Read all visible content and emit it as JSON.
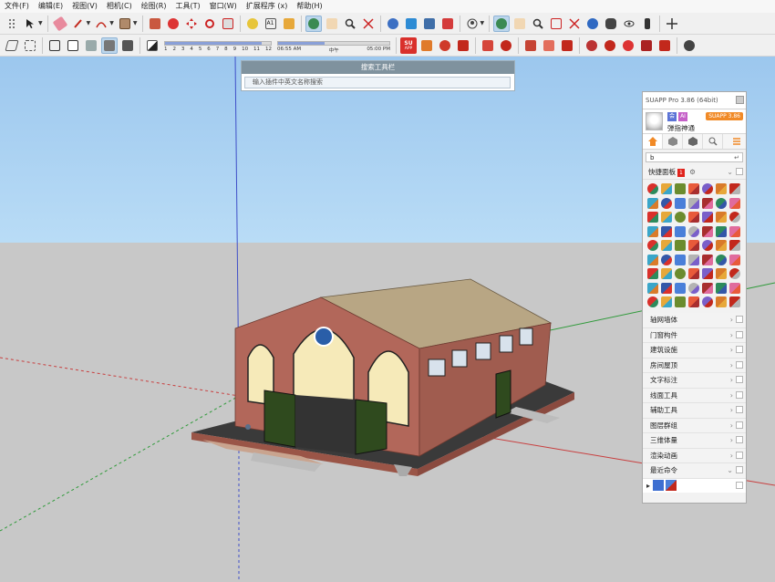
{
  "menu": [
    "文件(F)",
    "编辑(E)",
    "视图(V)",
    "相机(C)",
    "绘图(R)",
    "工具(T)",
    "窗口(W)",
    "扩展程序 (x)",
    "帮助(H)"
  ],
  "shadow_slider": {
    "months": [
      "1",
      "2",
      "3",
      "4",
      "5",
      "6",
      "7",
      "8",
      "9",
      "10",
      "11",
      "12"
    ],
    "month_value": 11,
    "time_labels": [
      "06:55 AM",
      "中午",
      "05:00 PM"
    ],
    "time_value": 0.42
  },
  "su_icon_label": {
    "top": "SU",
    "bottom": "APP"
  },
  "search_toolbar": {
    "title": "搜索工具栏",
    "placeholder": "输入插件中英文名称搜索"
  },
  "suapp": {
    "title": "SUAPP Pro 3.86 (64bit)",
    "version_badge": "SUAPP 3.86",
    "vip_badge": "会",
    "ai_badge": "AI",
    "user_name": "弹指神通",
    "quick_input": "b",
    "quick_panel": {
      "label": "快捷面板",
      "badge": "1"
    },
    "categories": [
      "轴网墙体",
      "门窗构件",
      "建筑设施",
      "房间屋顶",
      "文字标注",
      "线面工具",
      "辅助工具",
      "图层群组",
      "三维体量",
      "渲染动画",
      "最近命令"
    ],
    "recent_arrow": "▸"
  },
  "colors": {
    "sky_top": "#9cc7ee",
    "ground": "#c8c8c8",
    "brick": "#b2675a",
    "roof": "#b8a684",
    "door": "#2f4a1e",
    "accent_orange": "#f18a27"
  }
}
